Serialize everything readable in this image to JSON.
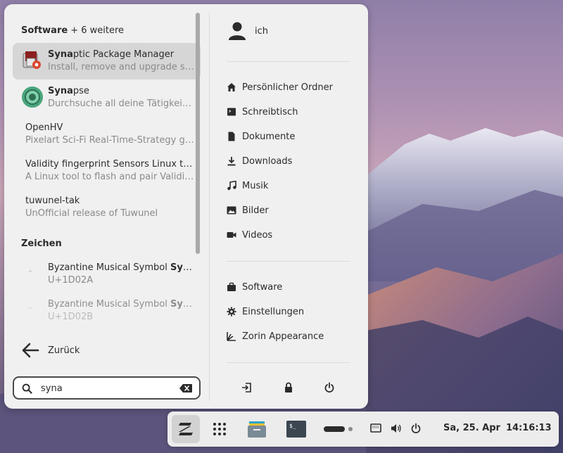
{
  "menu": {
    "software_section": {
      "title": "Software",
      "more": "+ 6 weitere"
    },
    "results": [
      {
        "title_match": "Syna",
        "title_rest": "ptic Package Manager",
        "desc": "Install, remove and upgrade software packages"
      },
      {
        "title_match": "Syna",
        "title_rest": "pse",
        "desc": "Durchsuche all deine Tätigkeiten und Dateien"
      },
      {
        "title": "OpenHV",
        "desc": "Pixelart Sci-Fi Real-Time-Strategy game"
      },
      {
        "title": "Validity fingerprint Sensors Linux tool",
        "desc": "A Linux tool to flash and pair Validity sensors"
      },
      {
        "title": "tuwunel-tak",
        "desc": "UnOfficial release of Tuwunel"
      }
    ],
    "characters_section": {
      "title": "Zeichen"
    },
    "characters": [
      {
        "title": "Byzantine Musical Symbol ",
        "title_bold": "Syrmatiki",
        "code": "U+1D02A"
      },
      {
        "title": "Byzantine Musical Symbol ",
        "title_bold": "Syrma",
        "code": "U+1D02B"
      }
    ],
    "back_label": "Zurück",
    "search": {
      "value": "syna",
      "placeholder": ""
    },
    "user_name": "ich",
    "places": [
      {
        "label": "Persönlicher Ordner",
        "icon": "home-icon"
      },
      {
        "label": "Schreibtisch",
        "icon": "desktop-icon"
      },
      {
        "label": "Dokumente",
        "icon": "document-icon"
      },
      {
        "label": "Downloads",
        "icon": "download-icon"
      },
      {
        "label": "Musik",
        "icon": "music-icon"
      },
      {
        "label": "Bilder",
        "icon": "image-icon"
      },
      {
        "label": "Videos",
        "icon": "video-icon"
      }
    ],
    "system": [
      {
        "label": "Software",
        "icon": "software-bag-icon"
      },
      {
        "label": "Einstellungen",
        "icon": "settings-gear-icon"
      },
      {
        "label": "Zorin Appearance",
        "icon": "appearance-icon"
      }
    ]
  },
  "taskbar": {
    "date": "Sa, 25. Apr",
    "time": "14:16:13"
  }
}
